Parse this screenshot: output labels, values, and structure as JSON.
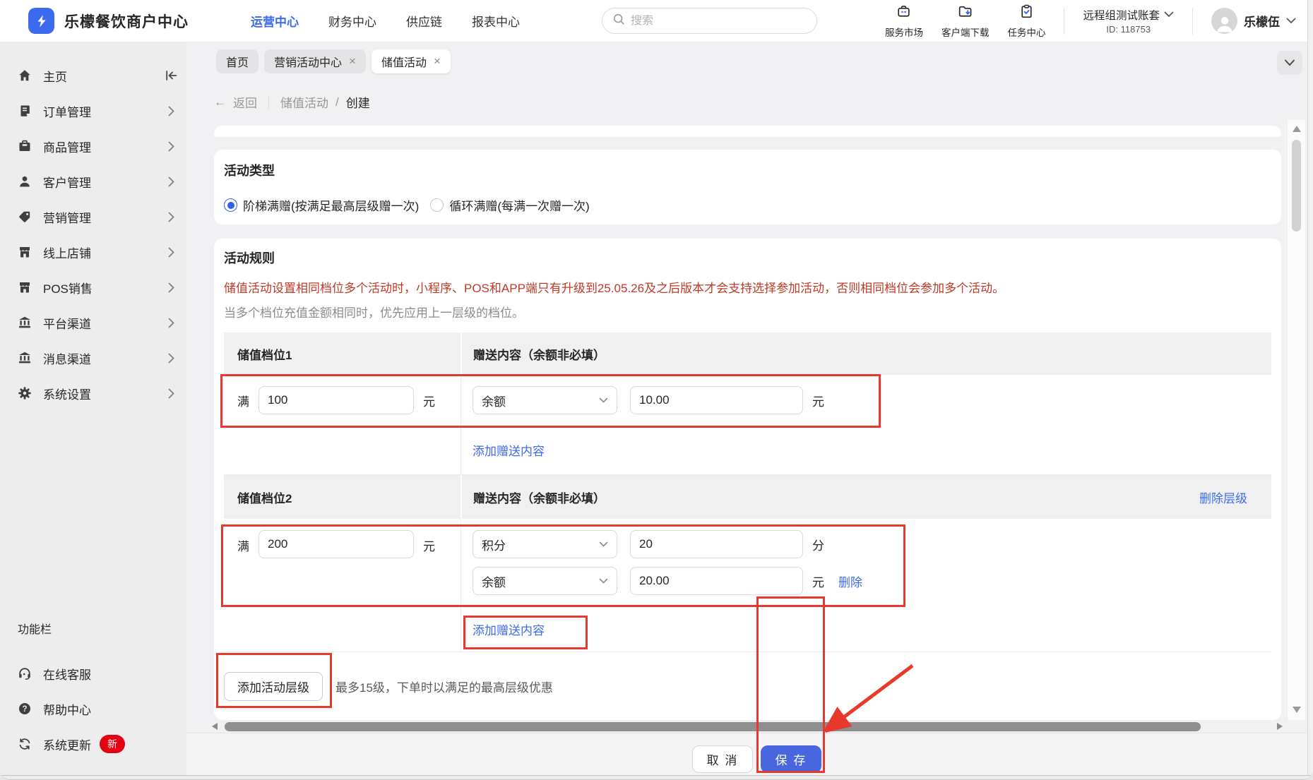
{
  "header": {
    "brand": "乐檬餐饮商户中心",
    "nav": [
      {
        "label": "运营中心"
      },
      {
        "label": "财务中心"
      },
      {
        "label": "供应链"
      },
      {
        "label": "报表中心"
      }
    ],
    "search_placeholder": "搜索",
    "quick_links": [
      {
        "label": "服务市场"
      },
      {
        "label": "客户端下载"
      },
      {
        "label": "任务中心"
      }
    ],
    "account_name": "远程组测试账套",
    "account_id": "ID: 118753",
    "user_name": "乐檬伍"
  },
  "sidebar": {
    "items": [
      {
        "label": "主页"
      },
      {
        "label": "订单管理"
      },
      {
        "label": "商品管理"
      },
      {
        "label": "客户管理"
      },
      {
        "label": "营销管理"
      },
      {
        "label": "线上店铺"
      },
      {
        "label": "POS销售"
      },
      {
        "label": "平台渠道"
      },
      {
        "label": "消息渠道"
      },
      {
        "label": "系统设置"
      }
    ],
    "section_label": "功能栏",
    "footer_items": [
      {
        "label": "在线客服"
      },
      {
        "label": "帮助中心"
      },
      {
        "label": "系统更新",
        "badge": "新"
      }
    ]
  },
  "tabs": {
    "items": [
      {
        "label": "首页"
      },
      {
        "label": "营销活动中心"
      },
      {
        "label": "储值活动"
      }
    ],
    "close_glyph": "×"
  },
  "breadcrumb": {
    "back_arrow": "←",
    "back": "返回",
    "parent": "储值活动",
    "separator": "/",
    "current": "创建"
  },
  "activity_type": {
    "title": "活动类型",
    "option1": "阶梯满赠(按满足最高层级赠一次)",
    "option2": "循环满赠(每满一次赠一次)"
  },
  "rules": {
    "title": "活动规则",
    "warning": "储值活动设置相同档位多个活动时，小程序、POS和APP端只有升级到25.05.26及之后版本才会支持选择参加活动，否则相同档位会参加多个活动。",
    "note": "当多个档位充值金额相同时，优先应用上一层级的档位。",
    "gift_col_header": "赠送内容（余额非必填）",
    "prefix": "满",
    "currency_unit": "元",
    "tier1": {
      "name": "储值档位1",
      "amount": "100",
      "gift_type": "余额",
      "gift_value": "10.00",
      "gift_unit": "元",
      "add_link": "添加赠送内容"
    },
    "tier2": {
      "name": "储值档位2",
      "amount": "200",
      "delete_level": "删除层级",
      "gift1_type": "积分",
      "gift1_value": "20",
      "gift1_unit": "分",
      "gift2_type": "余额",
      "gift2_value": "20.00",
      "gift2_unit": "元",
      "remove_link": "删除",
      "add_link": "添加赠送内容"
    },
    "add_tier_button": "添加活动层级",
    "tier_note": "最多15级，下单时以满足的最高层级优惠"
  },
  "footer": {
    "cancel": "取 消",
    "save": "保 存"
  },
  "colors": {
    "accent_blue": "#3d6bf0",
    "save_blue": "#4766e0",
    "annotation_red": "#e8392c",
    "warning_red": "#bf3a26",
    "badge_red": "#e60012"
  }
}
